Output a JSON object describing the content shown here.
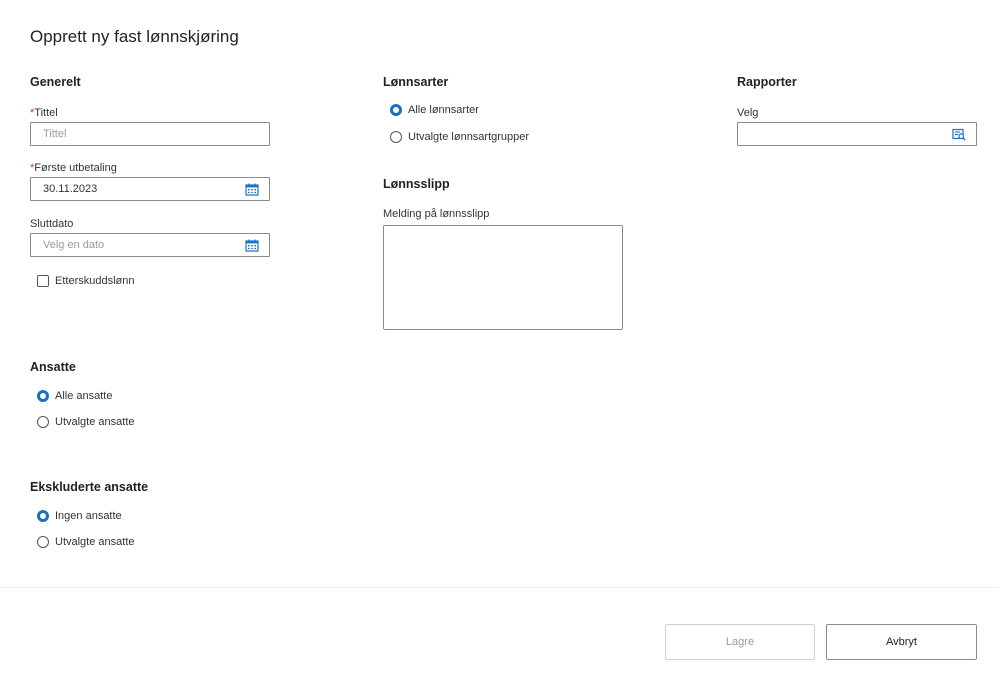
{
  "page": {
    "title": "Opprett ny fast lønnskjøring"
  },
  "general": {
    "heading": "Generelt",
    "title_field": {
      "required_mark": "*",
      "label": "Tittel",
      "placeholder": "Tittel",
      "value": ""
    },
    "first_payment": {
      "required_mark": "*",
      "label": "Første utbetaling",
      "value": "30.11.2023"
    },
    "end_date": {
      "label": "Sluttdato",
      "placeholder": "Velg en dato"
    },
    "arrears_checkbox": {
      "label": "Etterskuddslønn",
      "checked": false
    }
  },
  "wage_types": {
    "heading": "Lønnsarter",
    "options": [
      {
        "label": "Alle lønnsarter",
        "selected": true
      },
      {
        "label": "Utvalgte lønnsartgrupper",
        "selected": false
      }
    ]
  },
  "payslip": {
    "heading": "Lønnsslipp",
    "message_label": "Melding på lønnsslipp",
    "message_value": ""
  },
  "reports": {
    "heading": "Rapporter",
    "select_label": "Velg",
    "value": ""
  },
  "employees": {
    "heading": "Ansatte",
    "options": [
      {
        "label": "Alle ansatte",
        "selected": true
      },
      {
        "label": "Utvalgte ansatte",
        "selected": false
      }
    ]
  },
  "excluded_employees": {
    "heading": "Ekskluderte ansatte",
    "options": [
      {
        "label": "Ingen ansatte",
        "selected": true
      },
      {
        "label": "Utvalgte ansatte",
        "selected": false
      }
    ]
  },
  "footer": {
    "save_label": "Lagre",
    "cancel_label": "Avbryt"
  },
  "icons": {
    "calendar": "calendar-icon",
    "lookup": "search-list-icon"
  },
  "colors": {
    "accent": "#1b6fc2",
    "required": "#d0312d"
  }
}
